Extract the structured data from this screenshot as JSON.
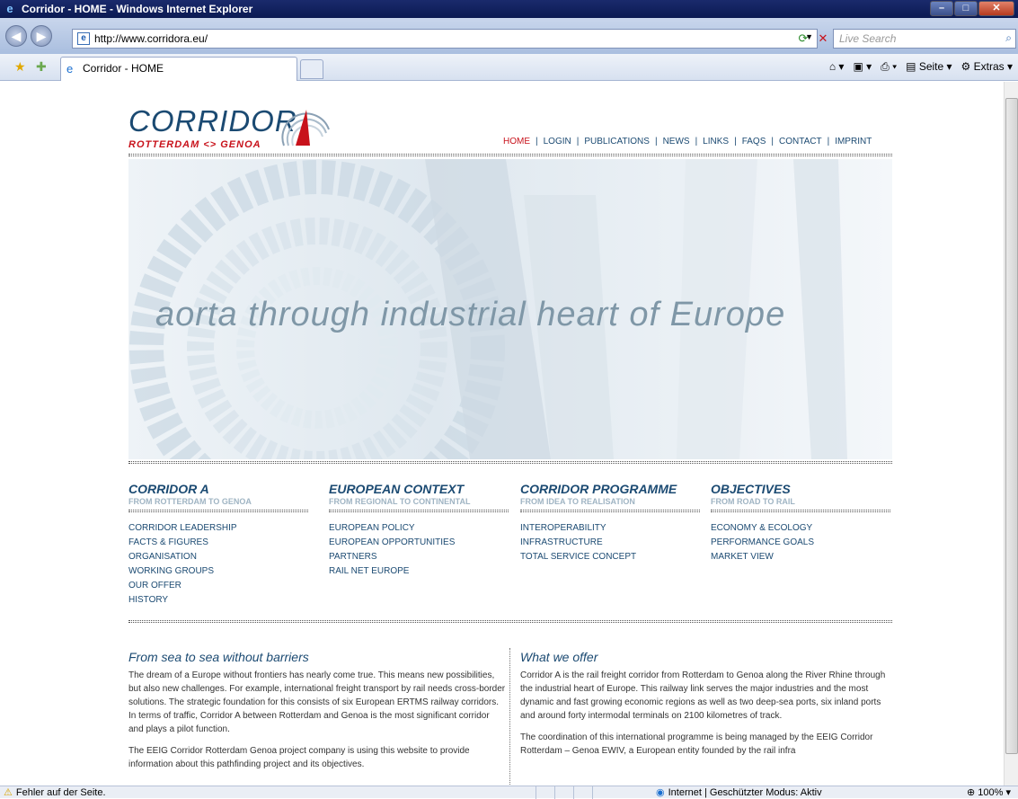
{
  "window": {
    "title": "Corridor - HOME - Windows Internet Explorer"
  },
  "address": {
    "url": "http://www.corridora.eu/",
    "search_placeholder": "Live Search"
  },
  "tab": {
    "title": "Corridor - HOME"
  },
  "command_bar": {
    "page_label": "Seite",
    "extras_label": "Extras"
  },
  "logo": {
    "name": "CORRIDOR",
    "route": "ROTTERDAM <> GENOA"
  },
  "nav": [
    {
      "label": "HOME"
    },
    {
      "label": "LOGIN"
    },
    {
      "label": "PUBLICATIONS"
    },
    {
      "label": "NEWS"
    },
    {
      "label": "LINKS"
    },
    {
      "label": "FAQS"
    },
    {
      "label": "CONTACT"
    },
    {
      "label": "IMPRINT"
    }
  ],
  "hero": {
    "tagline": "aorta through industrial heart of Europe"
  },
  "sections": [
    {
      "title": "CORRIDOR A",
      "subtitle": "FROM ROTTERDAM TO GENOA",
      "items": [
        "CORRIDOR LEADERSHIP",
        "FACTS & FIGURES",
        "ORGANISATION",
        "WORKING GROUPS",
        "OUR OFFER",
        "HISTORY"
      ]
    },
    {
      "title": "EUROPEAN CONTEXT",
      "subtitle": "FROM REGIONAL TO CONTINENTAL",
      "items": [
        "EUROPEAN POLICY",
        "EUROPEAN OPPORTUNITIES",
        "PARTNERS",
        "RAIL NET EUROPE"
      ]
    },
    {
      "title": "CORRIDOR PROGRAMME",
      "subtitle": "FROM IDEA TO REALISATION",
      "items": [
        "INTEROPERABILITY",
        "INFRASTRUCTURE",
        "TOTAL SERVICE CONCEPT"
      ]
    },
    {
      "title": "OBJECTIVES",
      "subtitle": "FROM ROAD TO RAIL",
      "items": [
        "ECONOMY & ECOLOGY",
        "PERFORMANCE GOALS",
        "MARKET VIEW"
      ]
    }
  ],
  "articles": [
    {
      "title": "From sea to sea without barriers",
      "paragraphs": [
        "The dream of a Europe without frontiers has nearly come true. This means new possibilities, but also new challenges. For example, international freight transport by rail needs cross-border solutions. The strategic foundation for this consists of six European ERTMS railway corridors. In terms of traffic, Corridor A between Rotterdam and Genoa is the most significant corridor and plays a pilot function.",
        "The EEIG Corridor Rotterdam Genoa project company is using this website to provide information about this pathfinding project and its objectives."
      ]
    },
    {
      "title": "What we offer",
      "paragraphs": [
        "Corridor A is the rail freight corridor from Rotterdam to Genoa along the River Rhine through the industrial heart of Europe. This railway link serves the major industries and the most dynamic and fast growing economic regions as well as two deep-sea ports, six inland ports and around forty intermodal terminals on 2100 kilometres of track.",
        "The coordination of this international programme is being managed by the EEIG Corridor Rotterdam – Genoa EWIV, a European entity founded by the rail infra"
      ]
    }
  ],
  "status": {
    "error_text": "Fehler auf der Seite.",
    "zone_text": "Internet | Geschützter Modus: Aktiv",
    "zoom": "100%"
  },
  "colors": {
    "brand_blue": "#1b4a72",
    "brand_red": "#c8121b",
    "subtitle_grey": "#9fb4c3"
  }
}
